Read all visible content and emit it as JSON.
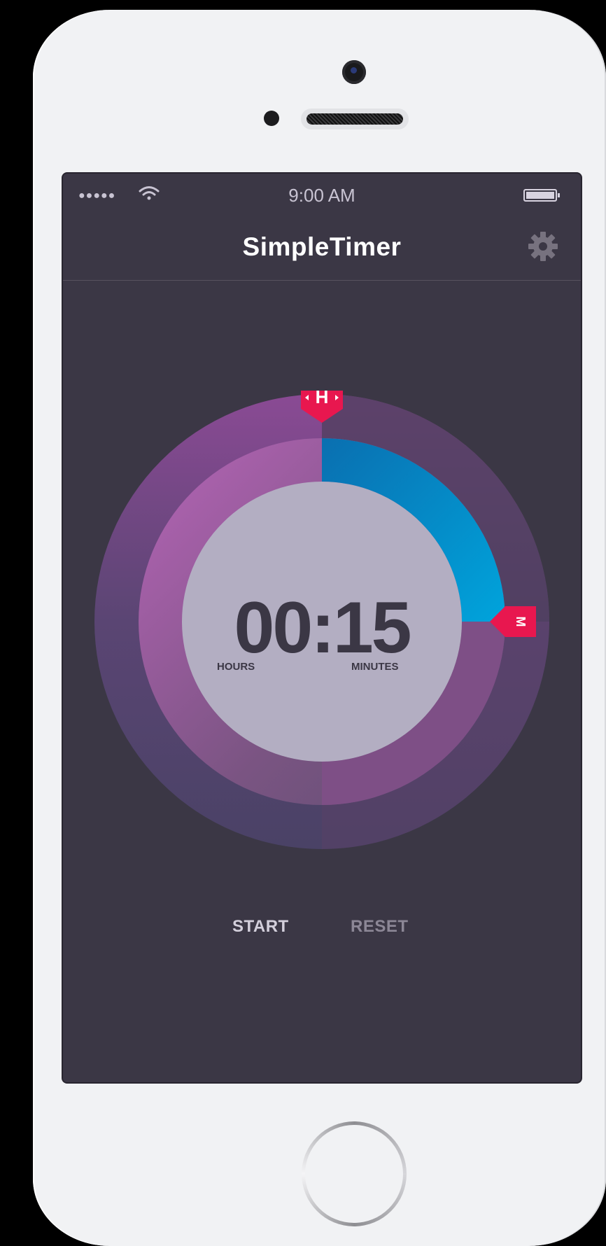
{
  "status_bar": {
    "signal": "●●●●●",
    "time": "9:00 AM",
    "wifi_icon": "wifi-icon",
    "battery_icon": "battery-icon"
  },
  "navbar": {
    "title": "SimpleTimer",
    "settings_icon": "gear-icon"
  },
  "timer": {
    "display": "00:15",
    "hours_label": "HOURS",
    "minutes_label": "MINUTES",
    "hours_handle_label": "H",
    "minutes_handle_label": "M",
    "hours_value": 0,
    "minutes_value": 15,
    "minutes_progress_fraction": 0.25
  },
  "controls": {
    "start_label": "START",
    "reset_label": "RESET"
  },
  "colors": {
    "screen_bg": "#3b3745",
    "accent_handle": "#e8174f",
    "minutes_arc": "#0098d4",
    "center_disc": "#b3aec2"
  }
}
